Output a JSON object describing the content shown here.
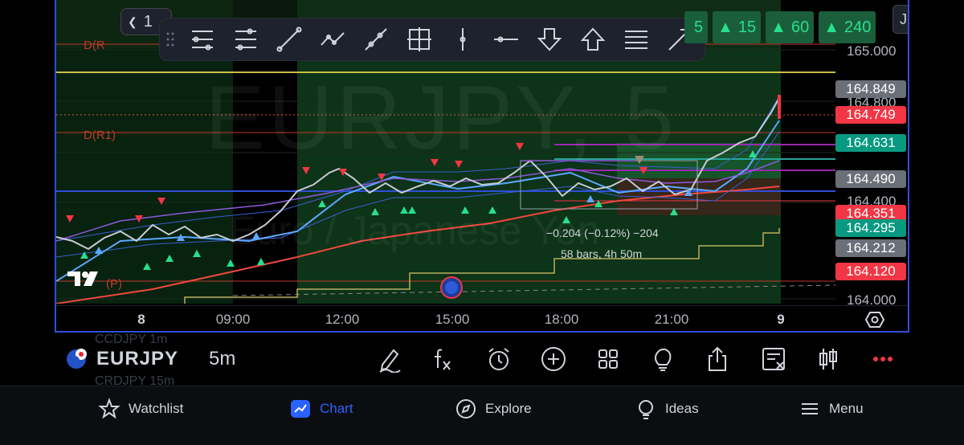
{
  "app": {
    "symbol": "EURJPY",
    "interval": "5m",
    "interval_short": "1",
    "quote_currency": "JPY"
  },
  "chart": {
    "watermark_symbol": "EURJPY, 5",
    "watermark_description": "Euro / Japanese Yen",
    "levels": {
      "d_r2": "D(R",
      "d_r1": "D(R1)",
      "d_p": "(P)"
    },
    "measurement": {
      "change": "−0.204 (−0.12%) −204",
      "range": "58 bars, 4h 50m"
    }
  },
  "timeframes": [
    {
      "label": "5",
      "icon": ""
    },
    {
      "label": "15",
      "icon": "▲"
    },
    {
      "label": "60",
      "icon": "▲"
    },
    {
      "label": "240",
      "icon": "▲"
    }
  ],
  "price_scale": {
    "ticks": [
      "165.000",
      "164.800",
      "164.400",
      "164.000"
    ],
    "labels": [
      {
        "value": "164.849",
        "color": "#6b6f78"
      },
      {
        "value": "164.749",
        "color": "#f23645"
      },
      {
        "value": "164.631",
        "color": "#089981"
      },
      {
        "value": "164.490",
        "color": "#6b6f78"
      },
      {
        "value": "164.351",
        "color": "#f23645"
      },
      {
        "value": "164.295",
        "color": "#089981"
      },
      {
        "value": "164.212",
        "color": "#6b6f78"
      },
      {
        "value": "164.120",
        "color": "#f23645"
      }
    ]
  },
  "time_axis": [
    "8",
    "09:00",
    "12:00",
    "15:00",
    "18:00",
    "21:00",
    "9"
  ],
  "symbol_bar": {
    "ghost_top": "CCDJPY 1m",
    "ghost_bottom": "CRDJPY 15m"
  },
  "nav": {
    "watchlist": "Watchlist",
    "chart": "Chart",
    "explore": "Explore",
    "ideas": "Ideas",
    "menu": "Menu"
  },
  "colors": {
    "accent": "#2962ff",
    "up": "#089981",
    "down": "#f23645",
    "frame": "#2f4fd8"
  }
}
